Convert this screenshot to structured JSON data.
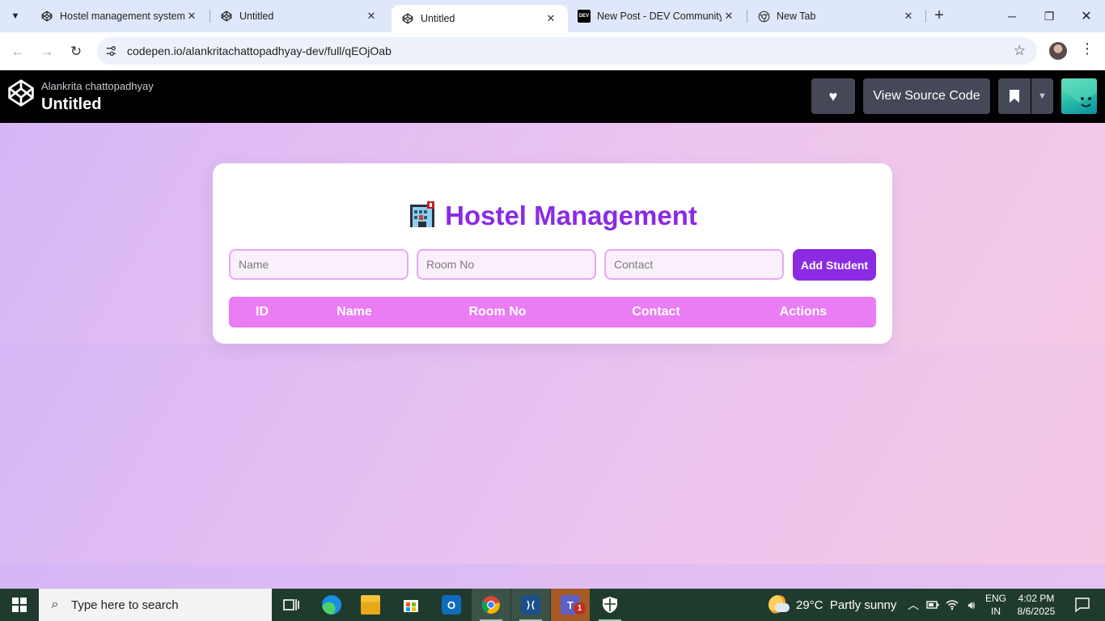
{
  "browser": {
    "tabs": [
      {
        "title": "Hostel management system",
        "favicon": "codepen-icon",
        "active": false
      },
      {
        "title": "Untitled",
        "favicon": "codepen-icon",
        "active": false
      },
      {
        "title": "Untitled",
        "favicon": "codepen-icon",
        "active": true
      },
      {
        "title": "New Post - DEV Community",
        "favicon": "dev-icon",
        "active": false
      },
      {
        "title": "New Tab",
        "favicon": "chrome-icon",
        "active": false
      }
    ],
    "dev_favicon_text": "DEV",
    "url": "codepen.io/alankritachattopadhyay-dev/full/qEOjOab"
  },
  "codepen": {
    "author": "Alankrita chattopadhyay",
    "title": "Untitled",
    "view_source_label": "View Source Code"
  },
  "app": {
    "heading": "Hostel Management",
    "heading_icon": "hotel-emoji",
    "inputs": {
      "name_placeholder": "Name",
      "room_placeholder": "Room No",
      "contact_placeholder": "Contact"
    },
    "add_button": "Add Student",
    "table_headers": [
      "ID",
      "Name",
      "Room No",
      "Contact",
      "Actions"
    ],
    "colors": {
      "accent": "#8a2be2",
      "table_header": "#ea7cf4",
      "input_border": "#e9a7f4"
    }
  },
  "taskbar": {
    "search_placeholder": "Type here to search",
    "teams_badge": "1",
    "weather": {
      "temp": "29°C",
      "condition": "Partly sunny"
    },
    "language": {
      "top": "ENG",
      "bottom": "IN"
    },
    "clock": {
      "time": "4:02 PM",
      "date": "8/6/2025"
    }
  }
}
